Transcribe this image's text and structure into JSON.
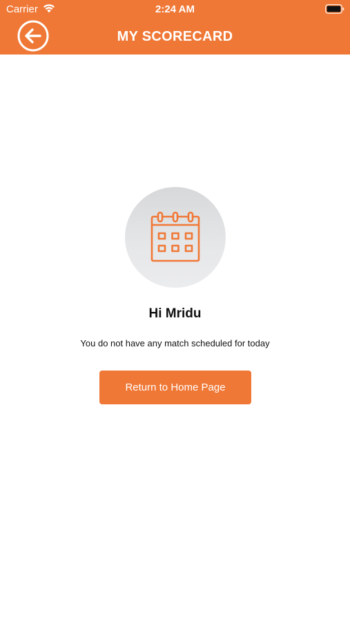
{
  "status_bar": {
    "carrier": "Carrier",
    "time": "2:24 AM",
    "wifi_icon": "wifi-icon",
    "battery_icon": "battery-icon"
  },
  "nav": {
    "title": "MY SCORECARD",
    "back_icon": "back-arrow-icon"
  },
  "empty_state": {
    "icon": "calendar-icon",
    "greeting": "Hi Mridu",
    "message": "You do not have any match scheduled for today",
    "button_label": "Return to Home Page"
  },
  "colors": {
    "brand": "#f07836",
    "circle_bg": "#e3e4e6",
    "text": "#111111",
    "background": "#ffffff"
  }
}
